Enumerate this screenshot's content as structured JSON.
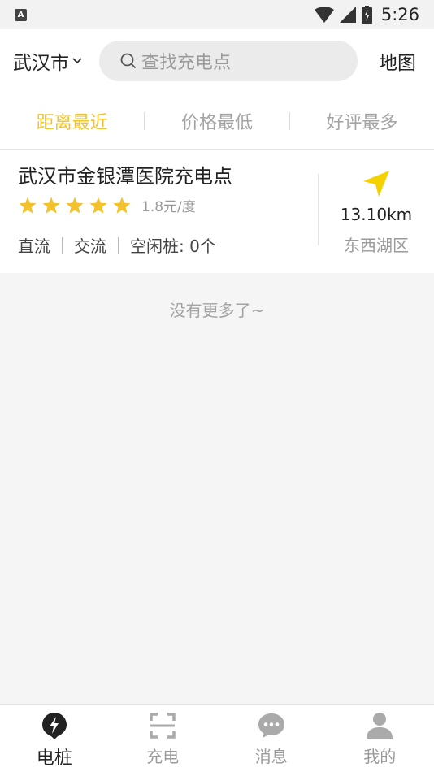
{
  "status_bar": {
    "time": "5:26",
    "app_icon_letter": "A"
  },
  "header": {
    "city": "武汉市",
    "search_placeholder": "查找充电点",
    "map_label": "地图"
  },
  "sort_tabs": [
    {
      "label": "距离最近",
      "active": true
    },
    {
      "label": "价格最低",
      "active": false
    },
    {
      "label": "好评最多",
      "active": false
    }
  ],
  "stations": [
    {
      "name": "武汉市金银潭医院充电点",
      "rating": 5,
      "price": "1.8元/度",
      "tags": [
        "直流",
        "交流",
        "空闲桩: 0个"
      ],
      "distance": "13.10km",
      "district": "东西湖区"
    }
  ],
  "no_more_text": "没有更多了~",
  "bottom_tabs": [
    {
      "label": "电桩",
      "icon": "charging-pile-icon",
      "active": true
    },
    {
      "label": "充电",
      "icon": "scan-icon",
      "active": false
    },
    {
      "label": "消息",
      "icon": "message-icon",
      "active": false
    },
    {
      "label": "我的",
      "icon": "profile-icon",
      "active": false
    }
  ],
  "colors": {
    "accent": "#f1c22e",
    "active_tab_icon": "#222222",
    "inactive": "#9a9a9a"
  }
}
